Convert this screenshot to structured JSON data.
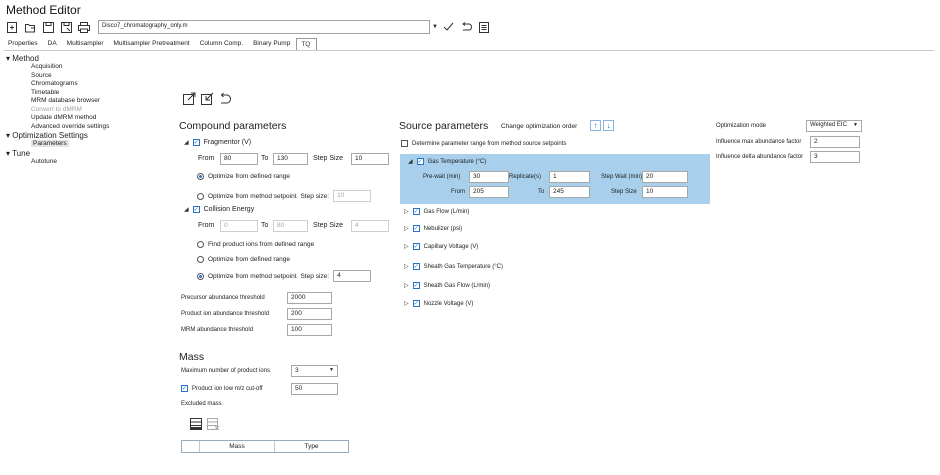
{
  "window": {
    "title": "Method Editor"
  },
  "toolbar": {
    "file_value": "Disco7_chromatography_only.m"
  },
  "tabs": [
    "Properties",
    "DA",
    "Multisampler",
    "Multisampler Pretreatment",
    "Column Comp.",
    "Binary Pump",
    "TQ"
  ],
  "tree": {
    "method": "Method",
    "method_items": [
      "Acquisition",
      "Source",
      "Chromatograms",
      "Timetable",
      "MRM database browser"
    ],
    "convert": "Convert to dMRM",
    "method_items2": [
      "Update dMRM method",
      "Advanced override settings"
    ],
    "optimization": "Optimization Settings",
    "parameters": "Parameters",
    "tune": "Tune",
    "autotune": "Autotune"
  },
  "compound": {
    "heading": "Compound parameters",
    "fragmentor": {
      "label": "Fragmentor (V)",
      "from_label": "From",
      "from": "80",
      "to_label": "To",
      "to": "130",
      "step_label": "Step Size",
      "step": "10",
      "opt_range": "Optimize from defined range",
      "opt_setpoint": "Optimize from method setpoint",
      "step_size_label": "Step size:",
      "step_size": "10"
    },
    "collision": {
      "label": "Collision Energy",
      "from_label": "From",
      "from": "0",
      "to_label": "To",
      "to": "80",
      "step_label": "Step Size",
      "step": "4",
      "find_product": "Find product ions from defined range",
      "opt_range": "Optimize from defined range",
      "opt_setpoint": "Optimize from method setpoint",
      "step_size_label": "Step size:",
      "step_size": "4"
    },
    "precursor_label": "Precursor abundance threshold",
    "precursor": "2000",
    "product_label": "Product ion abundance threshold",
    "product": "200",
    "mrm_label": "MRM abundance threshold",
    "mrm": "100"
  },
  "mass": {
    "heading": "Mass",
    "max_ions_label": "Maximum number of product ions",
    "max_ions": "3",
    "cutoff_label": "Product ion low m/z cut-off",
    "cutoff": "50",
    "excluded_label": "Excluded mass",
    "col_mass": "Mass",
    "col_type": "Type"
  },
  "source": {
    "heading": "Source parameters",
    "change_order": "Change optimization order",
    "determine": "Determine parameter range from method source setpoints",
    "gas_temp": {
      "label": "Gas Temperature (°C)",
      "prewait_label": "Pre-wait (min)",
      "prewait": "30",
      "replicate_label": "Replicate(s)",
      "replicate": "1",
      "stepwait_label": "Step Wait (min)",
      "stepwait": "20",
      "from_label": "From",
      "from": "205",
      "to_label": "To",
      "to": "245",
      "step_label": "Step Size",
      "step": "10"
    },
    "items": [
      "Gas Flow (L/min)",
      "Nebulizer (psi)",
      "Capillary Voltage (V)",
      "Sheath Gas Temperature (°C)",
      "Sheath Gas Flow (L/min)",
      "Nozzle Voltage (V)"
    ]
  },
  "optimization": {
    "mode_label": "Optimization mode",
    "mode": "Weighted EIC",
    "max_label": "Influence max abundance factor",
    "max": "2",
    "delta_label": "Influence delta abundance factor",
    "delta": "3"
  },
  "colors": {
    "accent": "#2a73c8",
    "highlight": "#a8d0ec"
  }
}
